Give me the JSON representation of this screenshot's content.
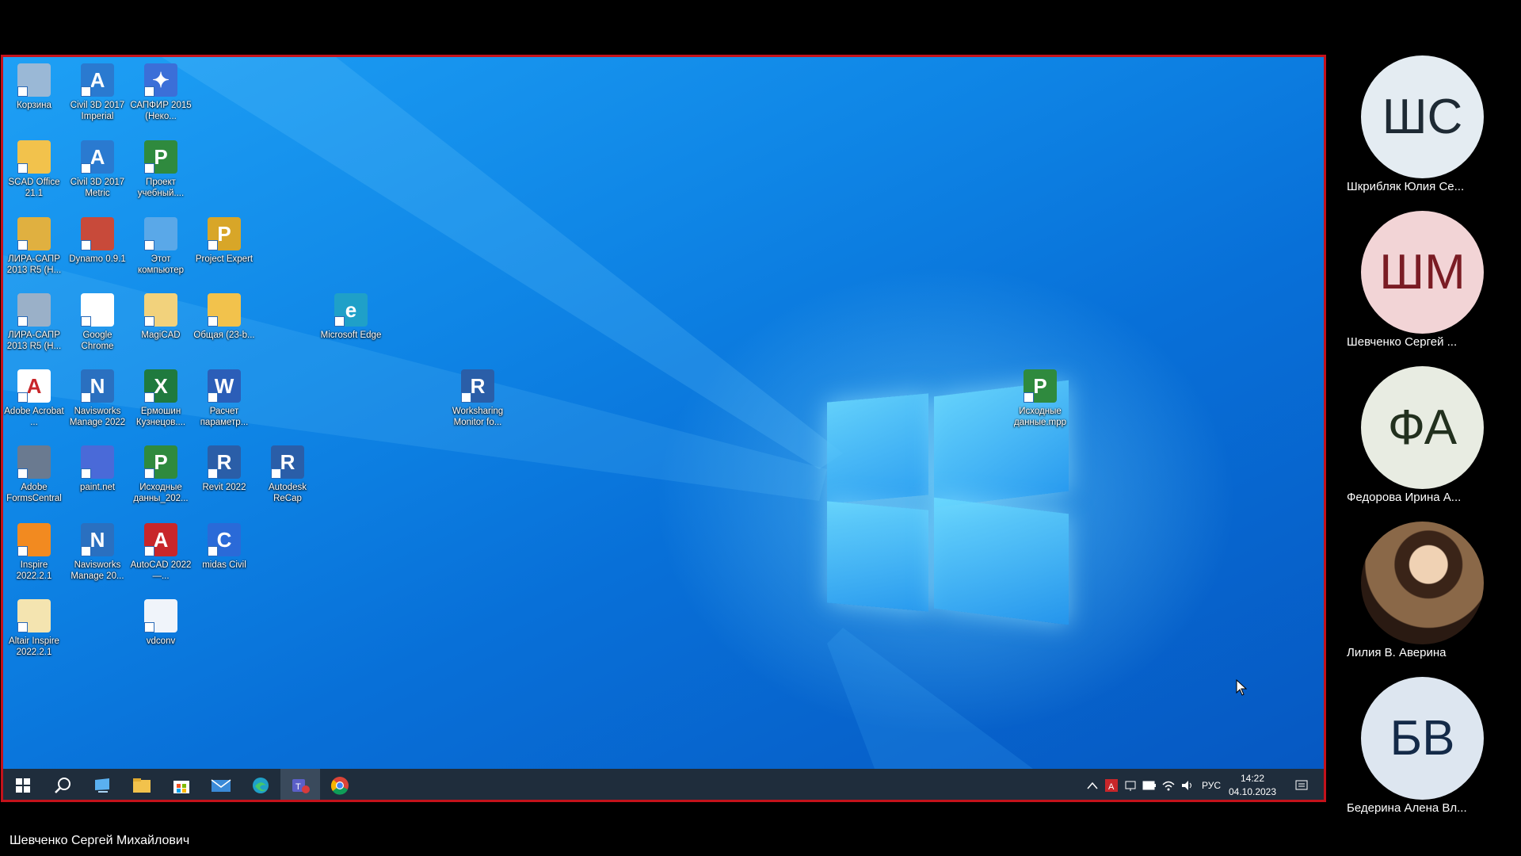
{
  "desktop": {
    "icons": [
      {
        "label": "Корзина",
        "icon": "recycle-bin-icon",
        "color": "#9ab8d6",
        "glyph": ""
      },
      {
        "label": "Civil 3D 2017 Imperial",
        "icon": "civil3d-icon",
        "color": "#2a7ad0",
        "glyph": "A"
      },
      {
        "label": "САПФИР 2015 (Неко...",
        "icon": "sapfir-icon",
        "color": "#3b6fd8",
        "glyph": "✦"
      },
      {
        "label": "SCAD Office 21.1",
        "icon": "folder-icon",
        "color": "#f2c24c",
        "glyph": ""
      },
      {
        "label": "Civil 3D 2017 Metric",
        "icon": "civil3d-icon",
        "color": "#2a7ad0",
        "glyph": "A"
      },
      {
        "label": "Проект учебный....",
        "icon": "project-file-icon",
        "color": "#2f8a3e",
        "glyph": "P"
      },
      {
        "label": "ЛИРА-САПР 2013 R5 (Н...",
        "icon": "lira-icon",
        "color": "#e0b040",
        "glyph": ""
      },
      {
        "label": "Dynamo 0.9.1",
        "icon": "dynamo-icon",
        "color": "#c84a3a",
        "glyph": ""
      },
      {
        "label": "Этот компьютер",
        "icon": "computer-icon",
        "color": "#5aa8e8",
        "glyph": ""
      },
      {
        "label": "Project Expert",
        "icon": "project-expert-icon",
        "color": "#d8a628",
        "glyph": "P"
      },
      {
        "label": "ЛИРА-САПР 2013 R5 (Н...",
        "icon": "lira-icon",
        "color": "#9ab0c8",
        "glyph": ""
      },
      {
        "label": "Google Chrome",
        "icon": "chrome-icon",
        "color": "#ffffff",
        "glyph": ""
      },
      {
        "label": "MagiCAD",
        "icon": "folder-icon",
        "color": "#f2d27c",
        "glyph": ""
      },
      {
        "label": "Общая (23-b...",
        "icon": "folder-shared-icon",
        "color": "#f2c24c",
        "glyph": ""
      },
      {
        "label": "Microsoft Edge",
        "icon": "edge-icon",
        "color": "#1fa0c8",
        "glyph": "e"
      },
      {
        "label": "Adobe Acrobat ...",
        "icon": "acrobat-icon",
        "color": "#ffffff",
        "glyph": "A"
      },
      {
        "label": "Navisworks Manage 2022",
        "icon": "navisworks-icon",
        "color": "#2a70c0",
        "glyph": "N"
      },
      {
        "label": "Ермошин Кузнецов....",
        "icon": "excel-file-icon",
        "color": "#1f7a3e",
        "glyph": "X"
      },
      {
        "label": "Расчет параметр...",
        "icon": "word-file-icon",
        "color": "#2b5eb8",
        "glyph": "W"
      },
      {
        "label": "Worksharing Monitor fo...",
        "icon": "revit-icon",
        "color": "#2a5ea8",
        "glyph": "R"
      },
      {
        "label": "Исходные данные.mpp",
        "icon": "project-file-icon",
        "color": "#2f8a3e",
        "glyph": "P"
      },
      {
        "label": "Adobe FormsCentral",
        "icon": "forms-icon",
        "color": "#6a7a90",
        "glyph": ""
      },
      {
        "label": "paint.net",
        "icon": "paintnet-icon",
        "color": "#4a6ad8",
        "glyph": ""
      },
      {
        "label": "Исходные данны_202...",
        "icon": "project-file-icon",
        "color": "#2f8a3e",
        "glyph": "P"
      },
      {
        "label": "Revit 2022",
        "icon": "revit-icon",
        "color": "#2a5ea8",
        "glyph": "R"
      },
      {
        "label": "Autodesk ReCap",
        "icon": "revit-icon",
        "color": "#2a5ea8",
        "glyph": "R"
      },
      {
        "label": "Inspire 2022.2.1",
        "icon": "inspire-icon",
        "color": "#f28a20",
        "glyph": ""
      },
      {
        "label": "Navisworks Manage 20...",
        "icon": "navisworks-icon",
        "color": "#2a70c0",
        "glyph": "N"
      },
      {
        "label": "AutoCAD 2022 —...",
        "icon": "autocad-icon",
        "color": "#c8262a",
        "glyph": "A"
      },
      {
        "label": "midas Civil",
        "icon": "midas-icon",
        "color": "#2a6ad8",
        "glyph": "C"
      },
      {
        "label": "Altair Inspire 2022.2.1",
        "icon": "altair-icon",
        "color": "#f4e4b0",
        "glyph": ""
      },
      {
        "label": "vdconv",
        "icon": "vdconv-icon",
        "color": "#f0f4fa",
        "glyph": ""
      }
    ]
  },
  "taskbar": {
    "tray": {
      "language": "РУС",
      "time": "14:22",
      "date": "04.10.2023"
    }
  },
  "participants": [
    {
      "initials": "ШС",
      "name": "Шкрибляк Юлия Се...",
      "bg": "#e4ecf2",
      "fg": "#1e2a34"
    },
    {
      "initials": "ШМ",
      "name": "Шевченко Сергей ...",
      "bg": "#f2d4d6",
      "fg": "#7a1c24"
    },
    {
      "initials": "ФА",
      "name": "Федорова Ирина А...",
      "bg": "#e8ece2",
      "fg": "#22301e"
    },
    {
      "initials": "",
      "name": "Лилия В. Аверина",
      "bg": "#6a4a32",
      "fg": "#ffffff"
    },
    {
      "initials": "БВ",
      "name": "Бедерина Алена Вл...",
      "bg": "#dde6f0",
      "fg": "#142a48"
    }
  ],
  "presenter": {
    "name": "Шевченко Сергей Михайлович"
  }
}
